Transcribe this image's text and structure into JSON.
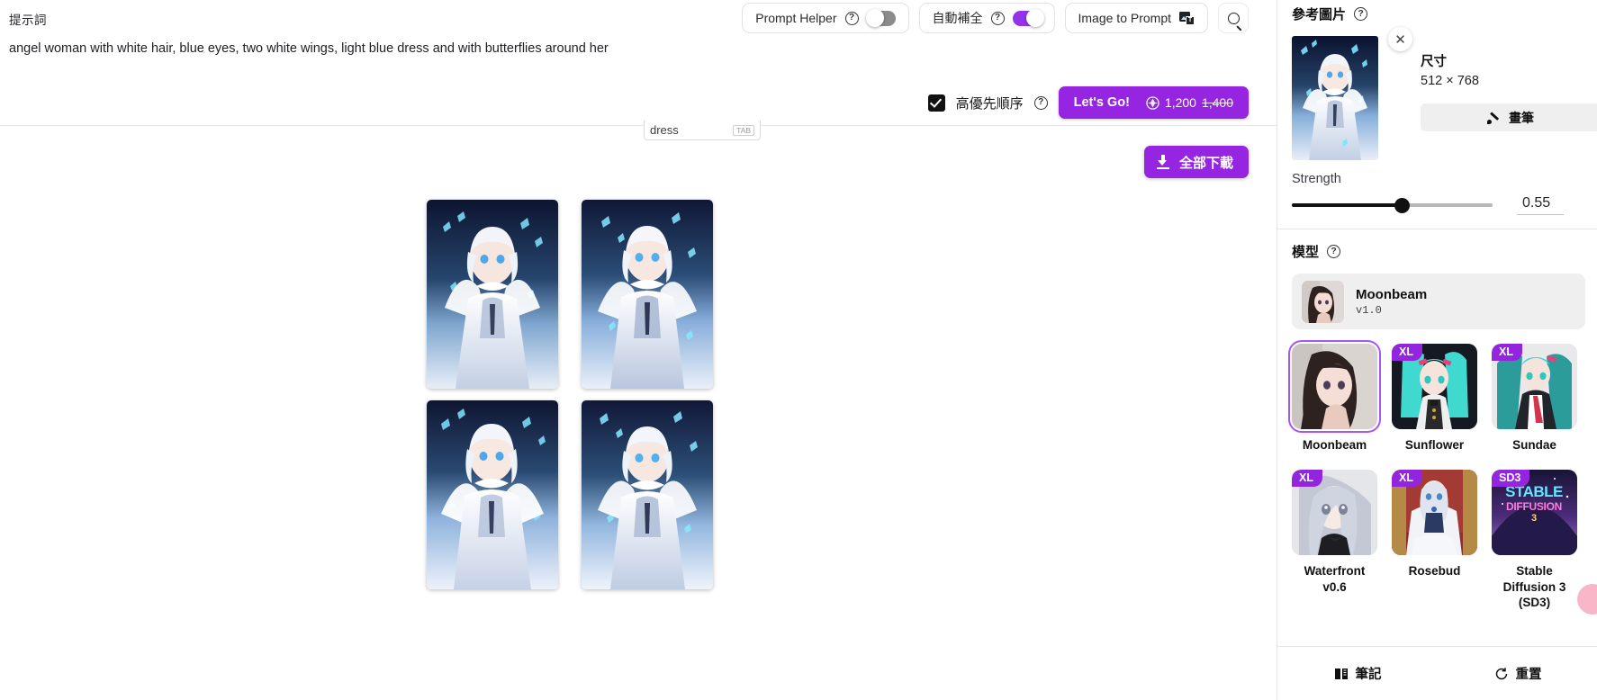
{
  "prompt": {
    "label": "提示詞",
    "text": "angel woman with white hair, blue eyes, two white wings, light blue dress and with butterflies around her"
  },
  "toolbar": {
    "prompt_helper": {
      "label": "Prompt Helper",
      "help_icon": "question-icon",
      "toggle_state": "off"
    },
    "autocomplete": {
      "label": "自動補全",
      "help_icon": "question-icon",
      "toggle_state": "on"
    },
    "image_to_prompt": {
      "label": "Image to Prompt",
      "icon": "image-to-text-icon"
    },
    "search": {
      "icon": "search-icon"
    }
  },
  "action_row": {
    "priority_label": "高優先順序",
    "priority_checked": true,
    "help_icon": "question-icon",
    "go_label": "Let's Go!",
    "price": "1,200",
    "price_original": "1,400",
    "coin_icon": "coin-icon"
  },
  "results": {
    "download_all_label": "全部下載",
    "download_icon": "download-icon",
    "ghost_chip": {
      "text": "dress",
      "key": "TAB"
    },
    "image_count": 4
  },
  "reference": {
    "title": "參考圖片",
    "help_icon": "question-icon",
    "close_icon": "close-icon",
    "size_label": "尺寸",
    "size_value": "512 × 768",
    "brush_label": "畫筆",
    "brush_icon": "brush-icon",
    "strength_label": "Strength",
    "strength_value": "0.55",
    "strength_percent": 55
  },
  "model": {
    "title": "模型",
    "help_icon": "question-icon",
    "current": {
      "name": "Moonbeam",
      "version": "v1.0"
    },
    "items": [
      {
        "name": "Moonbeam",
        "badge": "",
        "selected": true
      },
      {
        "name": "Sunflower",
        "badge": "XL",
        "selected": false
      },
      {
        "name": "Sundae",
        "badge": "XL",
        "selected": false
      },
      {
        "name": "Waterfront v0.6",
        "badge": "XL",
        "selected": false
      },
      {
        "name": "Rosebud",
        "badge": "XL",
        "selected": false
      },
      {
        "name": "Stable Diffusion 3 (SD3)",
        "badge": "SD3",
        "selected": false
      }
    ]
  },
  "footer": {
    "notes_label": "筆記",
    "notes_icon": "book-icon",
    "reset_label": "重置",
    "reset_icon": "reset-icon"
  },
  "colors": {
    "accent_purple": "#9525e0",
    "toggle_on": "#9333ea",
    "selection_border": "#a855f7"
  }
}
